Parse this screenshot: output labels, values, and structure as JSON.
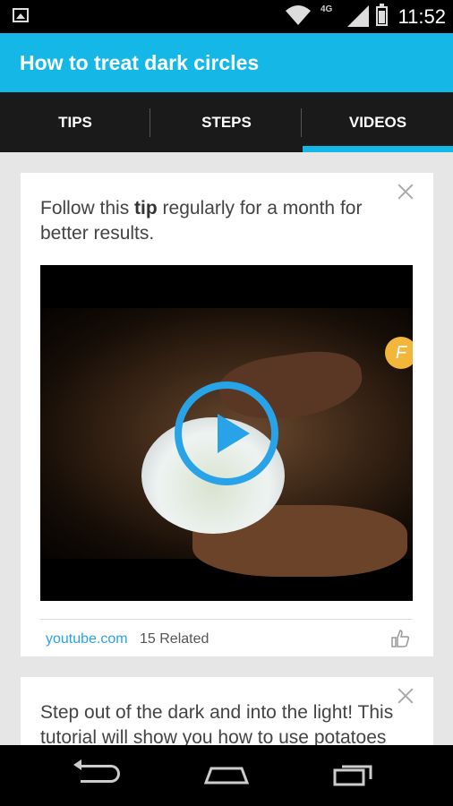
{
  "status_bar": {
    "time": "11:52",
    "network": "4G"
  },
  "app_bar": {
    "title": "How to treat dark circles"
  },
  "tabs": [
    {
      "label": "TIPS",
      "active": false
    },
    {
      "label": "STEPS",
      "active": false
    },
    {
      "label": "VIDEOS",
      "active": true
    }
  ],
  "cards": [
    {
      "text_before": "Follow this ",
      "text_bold": "tip",
      "text_after": " regularly for a month for better results.",
      "video": {
        "logo_letter": "F"
      },
      "source": "youtube.com",
      "related": "15 Related"
    },
    {
      "text": "Step out of the dark and into the light! This tutorial will show you how to use potatoes"
    }
  ],
  "colors": {
    "accent": "#15b7e6",
    "play": "#29a3e8",
    "tabs_bg": "#1a1a1a"
  }
}
